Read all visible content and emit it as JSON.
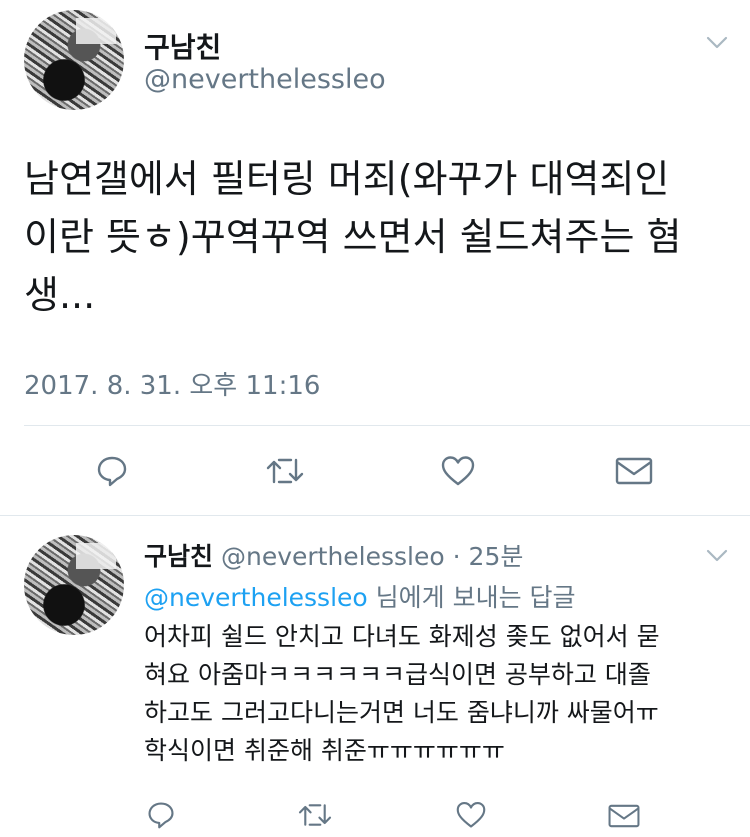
{
  "main_tweet": {
    "display_name": "구남친",
    "handle": "@neverthelessleo",
    "text_lines": [
      "남연갤에서 필터링 머죄(와꾸가 대역죄인",
      "이란 뜻ㅎ)꾸역꾸역 쓰면서 쉴드쳐주는 혐",
      "생..."
    ],
    "timestamp": "2017. 8. 31. 오후 11:16",
    "icons": {
      "menu": "chevron-down-icon",
      "reply": "reply-icon",
      "retweet": "retweet-icon",
      "like": "heart-icon",
      "dm": "envelope-icon"
    }
  },
  "reply_tweet": {
    "display_name": "구남친",
    "handle": "@neverthelessleo",
    "separator": "·",
    "time": "25분",
    "reply_to_mention": "@neverthelessleo",
    "reply_to_suffix": " 님에게 보내는 답글",
    "text_lines": [
      "어차피 쉴드 안치고 다녀도 화제성 좆도 없어서 묻",
      "혀요 아줌마ㅋㅋㅋㅋㅋㅋ급식이면 공부하고 대졸",
      "하고도 그러고다니는거면 너도 줌냐니까 싸물어ㅠ",
      "학식이면 취준해 취준ㅠㅠㅠㅠㅠㅠ"
    ]
  },
  "colors": {
    "text": "#14171a",
    "secondary": "#657786",
    "link": "#1da1f2",
    "divider": "#e1e8ed",
    "chevron": "#aab8c2"
  }
}
